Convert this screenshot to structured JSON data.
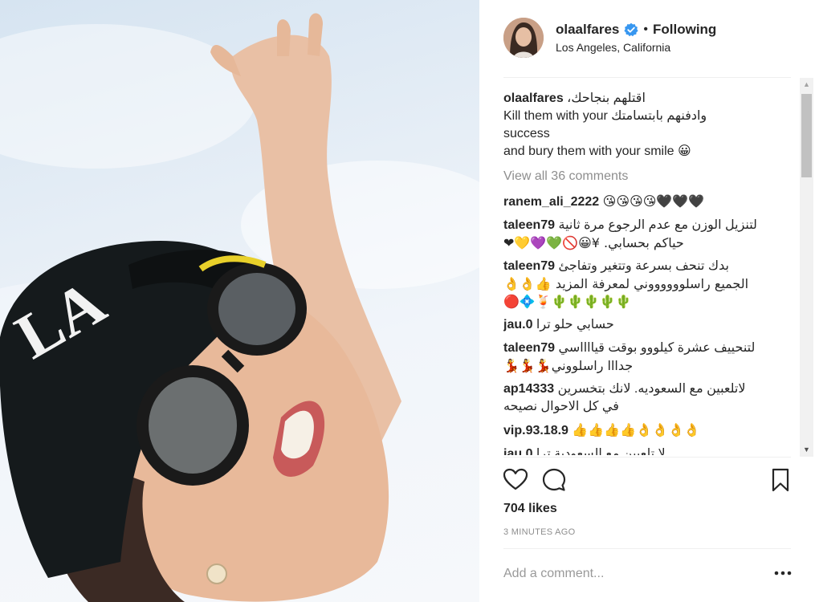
{
  "post": {
    "image_description": "woman wearing black cap and sunglasses, arm raised against sky",
    "header": {
      "username": "olaalfares",
      "verified": true,
      "separator": "•",
      "follow_state": "Following",
      "location": "Los Angeles, California"
    },
    "caption": {
      "username": "olaalfares",
      "lines": [
        "اقتلهم بنجاحك،",
        "وادفنهم بابتسامتك Kill them with your",
        "success",
        "and bury them with your smile 😀"
      ]
    },
    "view_all_comments": "View all 36 comments",
    "comments": [
      {
        "username": "ranem_ali_2222",
        "lines": [
          "😘😘😘😘🖤🖤🖤"
        ]
      },
      {
        "username": "taleen79",
        "lines": [
          "لتنزيل الوزن مع عدم الرجوع مرة ثانية",
          "حياكم بحسابي. ¥😀🚫💚💜💛❤"
        ]
      },
      {
        "username": "taleen79",
        "lines": [
          "بدك تنحف بسرعة وتتغير وتفاجئ",
          "الجميع راسلووووووني لمعرفة المزيد 👍👌👌",
          "🔴💠🍹🌵🌵🌵🌵🌵"
        ]
      },
      {
        "username": "jau.0",
        "lines": [
          "حسابي حلو ترا"
        ]
      },
      {
        "username": "taleen79",
        "lines": [
          "لتنحييف عشرة كيلووو بوقت قيااااسي",
          "جدااا راسلووني💃💃💃"
        ]
      },
      {
        "username": "ap14333",
        "lines": [
          "لاتلعبين مع السعوديه. لانك بتخسرين",
          "في كل الاحوال نصيحه"
        ]
      },
      {
        "username": "vip.93.18.9",
        "lines": [
          "👍👍👍👍👌👌👌👌"
        ]
      },
      {
        "username": "jau.0",
        "lines": [
          "لا تلعبين مع السعودية ترا"
        ]
      }
    ],
    "likes": "704 likes",
    "timestamp": "3 MINUTES AGO",
    "add_comment_placeholder": "Add a comment...",
    "icons": {
      "like": "heart-icon",
      "comment": "comment-icon",
      "save": "bookmark-icon",
      "more": "more-dots-icon",
      "verified": "verified-badge-icon"
    },
    "colors": {
      "text": "#262626",
      "muted": "#8e8e8e",
      "verified": "#3897f0",
      "divider": "#efefef"
    }
  }
}
